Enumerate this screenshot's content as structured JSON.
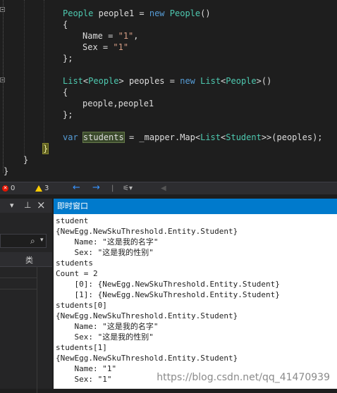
{
  "editor": {
    "people1": {
      "type": "People",
      "var": "people1",
      "kw_new": "new",
      "ctor": "People",
      "parens": "()"
    },
    "open_brace": "{",
    "name_prop": "Name",
    "name_val": "\"1\"",
    "sex_prop": "Sex",
    "sex_val": "\"1\"",
    "close_brace_semi": "};",
    "list_type": "List",
    "list_arg": "People",
    "peoples": "peoples",
    "list_ctor": "List",
    "list_ctor_arg": "People",
    "init_items": "people,people1",
    "kw_var": "var",
    "students": "students",
    "mapper_call": "= _mapper.Map",
    "map_outer": "List",
    "map_inner": "Student",
    "map_args": ">>(peoples);",
    "brace_close": "}"
  },
  "error_bar": {
    "errors": "0",
    "warnings": "3",
    "back_icon": "back-arrow-icon",
    "forward_icon": "forward-arrow-icon"
  },
  "left_pane": {
    "pin": "⊡",
    "pin2": "ꟷ",
    "close": "×",
    "search_icon": "⚲",
    "col_header": "类"
  },
  "immediate_window": {
    "title": "即时窗口",
    "lines": [
      "student",
      "{NewEgg.NewSkuThreshold.Entity.Student}",
      "    Name: \"这是我的名字\"",
      "    Sex: \"这是我的性别\"",
      "students",
      "Count = 2",
      "    [0]: {NewEgg.NewSkuThreshold.Entity.Student}",
      "    [1]: {NewEgg.NewSkuThreshold.Entity.Student}",
      "students[0]",
      "{NewEgg.NewSkuThreshold.Entity.Student}",
      "    Name: \"这是我的名字\"",
      "    Sex: \"这是我的性别\"",
      "students[1]",
      "{NewEgg.NewSkuThreshold.Entity.Student}",
      "    Name: \"1\"",
      "    Sex: \"1\""
    ]
  },
  "watermark": "https://blog.csdn.net/qq_41470939",
  "colors": {
    "accent": "#007acc",
    "editor_bg": "#1e1e1e"
  }
}
